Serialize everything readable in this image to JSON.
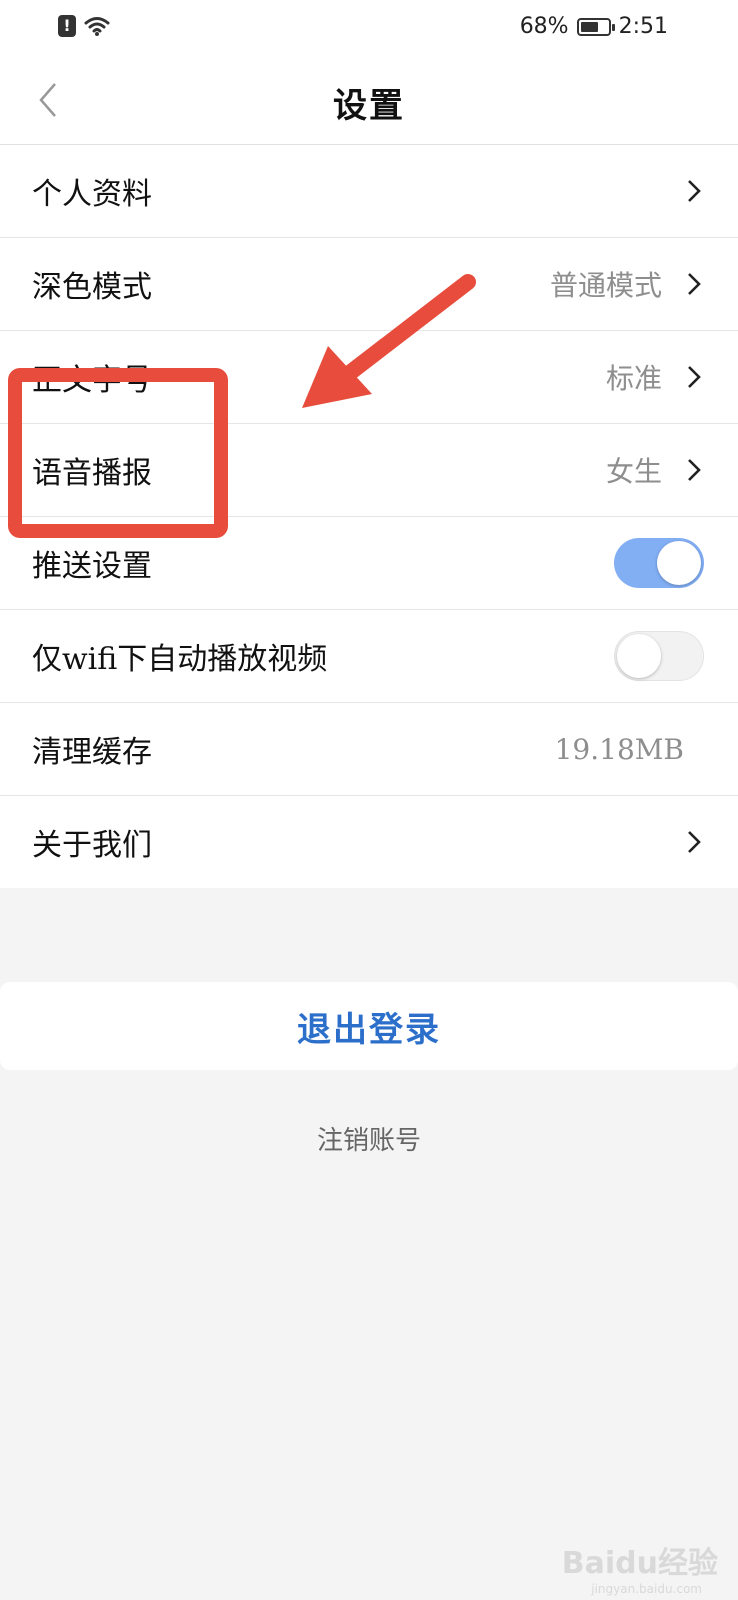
{
  "status_bar": {
    "battery_percent": "68%",
    "battery_level": 0.68,
    "time": "2:51"
  },
  "header": {
    "title": "设置"
  },
  "settings": [
    {
      "label": "个人资料",
      "value": "",
      "control": "chevron"
    },
    {
      "label": "深色模式",
      "value": "普通模式",
      "control": "chevron"
    },
    {
      "label": "正文字号",
      "value": "标准",
      "control": "chevron"
    },
    {
      "label": "语音播报",
      "value": "女生",
      "control": "chevron"
    },
    {
      "label": "推送设置",
      "value": "",
      "control": "toggle",
      "toggle_on": true
    },
    {
      "label": "仅wifi下自动播放视频",
      "value": "",
      "control": "toggle",
      "toggle_on": false
    },
    {
      "label": "清理缓存",
      "value": "19.18MB",
      "control": "none"
    },
    {
      "label": "关于我们",
      "value": "",
      "control": "chevron"
    }
  ],
  "logout": {
    "label": "退出登录"
  },
  "deactivate": {
    "label": "注销账号"
  },
  "annotation": {
    "color": "#e74c3c"
  },
  "watermark": {
    "text": "Baidu经验",
    "sub": "jingyan.baidu.com"
  },
  "colors": {
    "accent": "#2b6fca",
    "toggle_on": "#82aef4"
  }
}
